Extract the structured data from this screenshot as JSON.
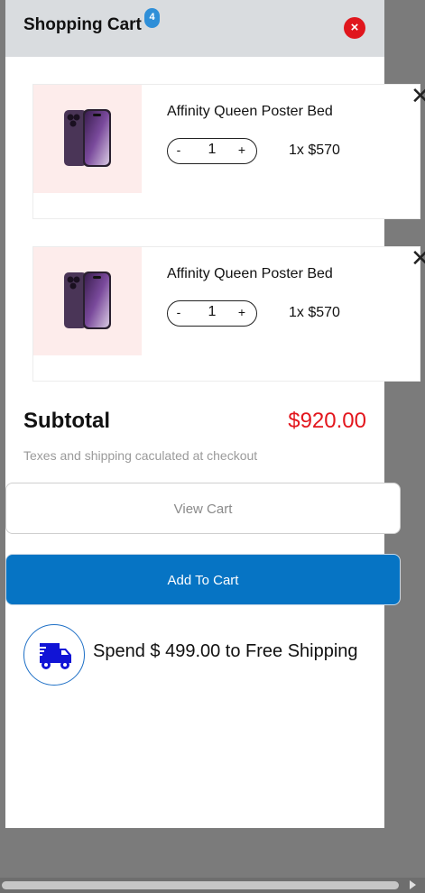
{
  "header": {
    "title": "Shopping Cart",
    "count": "4",
    "close_symbol": "×"
  },
  "items": [
    {
      "name": "Affinity Queen Poster Bed",
      "quantity": "1",
      "price": "1x $570",
      "minus": "-",
      "plus": "+",
      "remove": "✕"
    },
    {
      "name": "Affinity Queen Poster Bed",
      "quantity": "1",
      "price": "1x $570",
      "minus": "-",
      "plus": "+",
      "remove": "✕"
    }
  ],
  "summary": {
    "subtotal_label": "Subtotal",
    "subtotal_value": "$920.00",
    "note": "Texes and shipping caculated at checkout"
  },
  "buttons": {
    "view_cart": "View Cart",
    "add_to_cart": "Add To Cart"
  },
  "promo": {
    "text": "Spend $ 499.00 to Free Shipping",
    "icon": "truck-icon"
  },
  "colors": {
    "accent": "#0674c4",
    "price": "#e3161d",
    "close": "#e0161d",
    "badge": "#2f8fd8"
  }
}
